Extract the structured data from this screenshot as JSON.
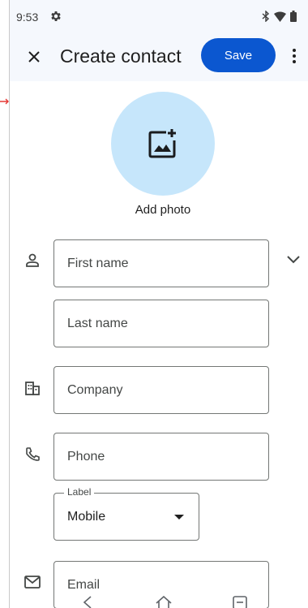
{
  "status_bar": {
    "time": "9:53",
    "icons": [
      "gear-icon",
      "bluetooth-icon",
      "wifi-icon",
      "battery-icon"
    ]
  },
  "app_bar": {
    "close_icon": "close-icon",
    "title": "Create contact",
    "save_label": "Save",
    "more_icon": "more-vert-icon"
  },
  "photo": {
    "icon": "add-photo-icon",
    "label": "Add photo"
  },
  "form": {
    "first_name": {
      "placeholder": "First name",
      "value": ""
    },
    "last_name": {
      "placeholder": "Last name",
      "value": ""
    },
    "company": {
      "placeholder": "Company",
      "value": ""
    },
    "phone": {
      "placeholder": "Phone",
      "value": ""
    },
    "phone_label": {
      "legend": "Label",
      "selected": "Mobile"
    },
    "email": {
      "placeholder": "Email",
      "value": ""
    }
  },
  "colors": {
    "accent": "#0b57d0",
    "photo_bg": "#c6e6fb",
    "app_bar_bg": "#f5f8fd"
  },
  "nav_bar": {
    "icons": [
      "back-icon",
      "home-icon",
      "recents-icon"
    ]
  }
}
